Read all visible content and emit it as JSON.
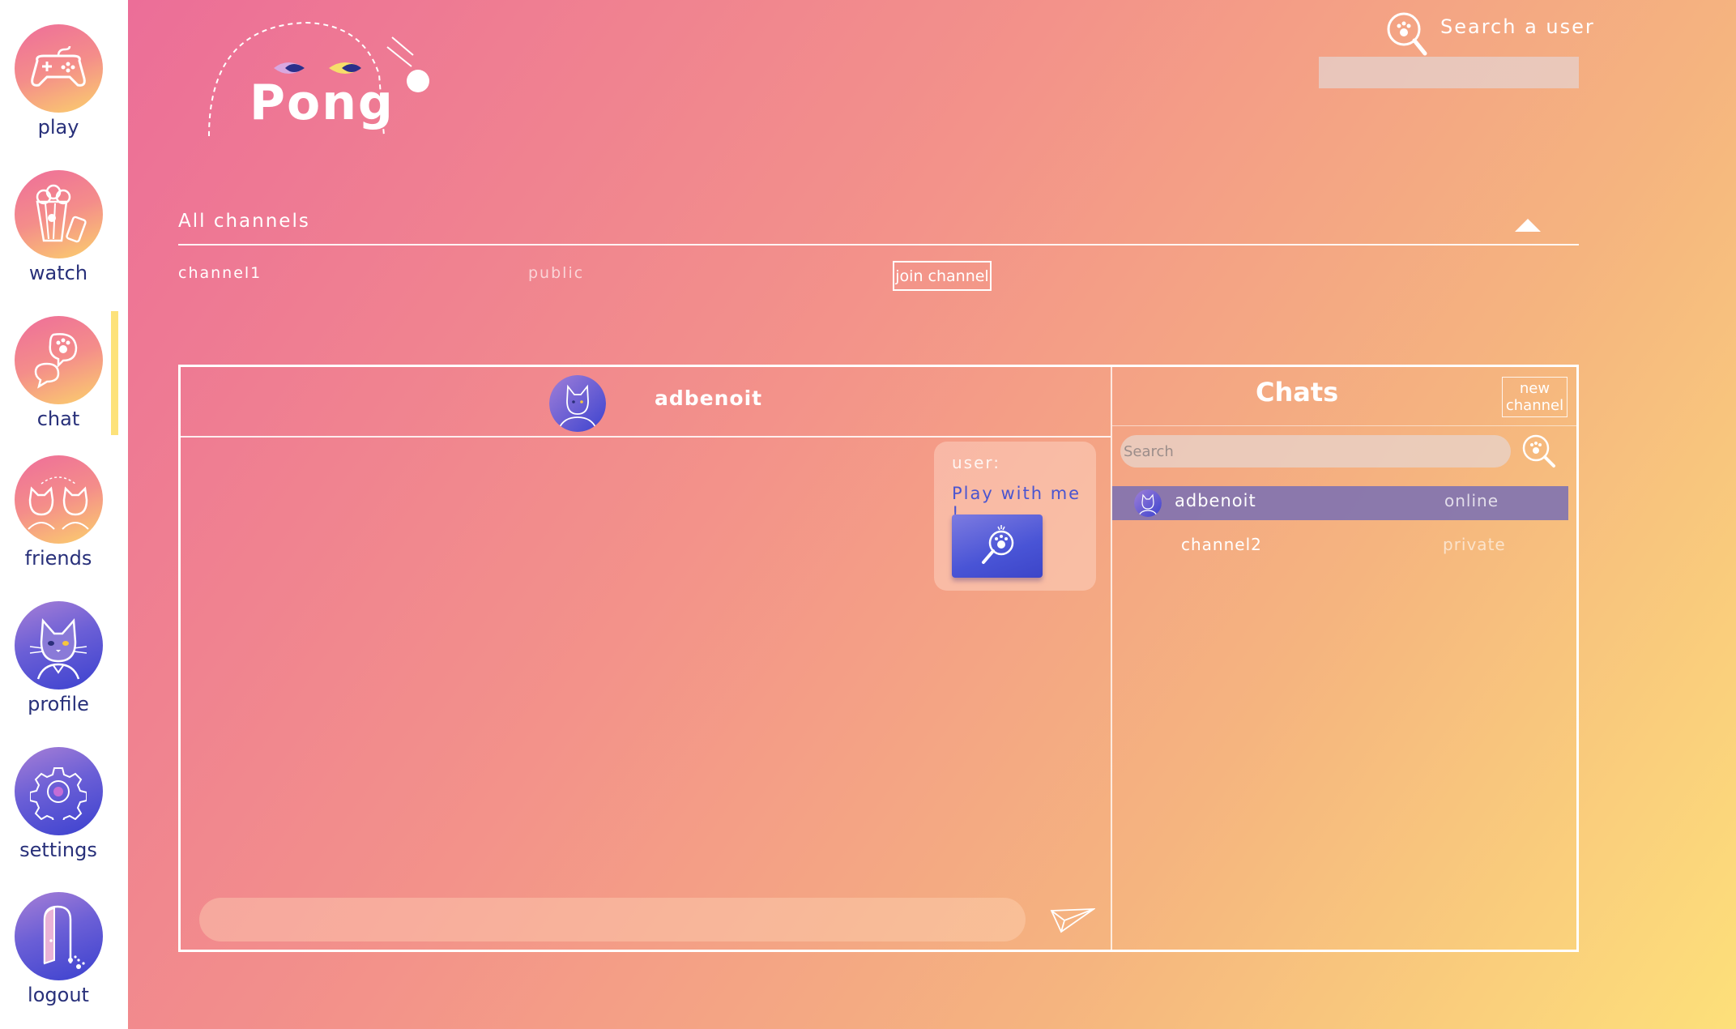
{
  "sidebar": {
    "items": [
      {
        "label": "play",
        "icon": "gamepad-icon"
      },
      {
        "label": "watch",
        "icon": "popcorn-icon"
      },
      {
        "label": "chat",
        "icon": "chat-bubbles-icon"
      },
      {
        "label": "friends",
        "icon": "cats-icon"
      },
      {
        "label": "profile",
        "icon": "cat-avatar-icon"
      },
      {
        "label": "settings",
        "icon": "gear-icon"
      },
      {
        "label": "logout",
        "icon": "door-icon"
      }
    ],
    "active": "chat"
  },
  "header": {
    "logo_text": "Pong",
    "user_search_label": "Search a user",
    "user_search_value": ""
  },
  "channels": {
    "title": "All channels",
    "items": [
      {
        "name": "channel1",
        "type": "public",
        "action": "join channel"
      }
    ]
  },
  "conversation": {
    "username": "adbenoit",
    "messages": [
      {
        "sender": "user:",
        "text": "Play with me !",
        "attachment_icon": "ping-pong-paddle-icon"
      }
    ],
    "input_value": ""
  },
  "chats": {
    "title": "Chats",
    "new_channel_label": "new channel",
    "search_placeholder": "Search",
    "items": [
      {
        "name": "adbenoit",
        "status": "online",
        "selected": true
      },
      {
        "name": "channel2",
        "status": "private",
        "selected": false
      }
    ]
  },
  "colors": {
    "accent_dark": "#28307a",
    "message_text": "#4a55d0",
    "active_marker": "#fde27a",
    "selected_row": "#786eb4"
  }
}
